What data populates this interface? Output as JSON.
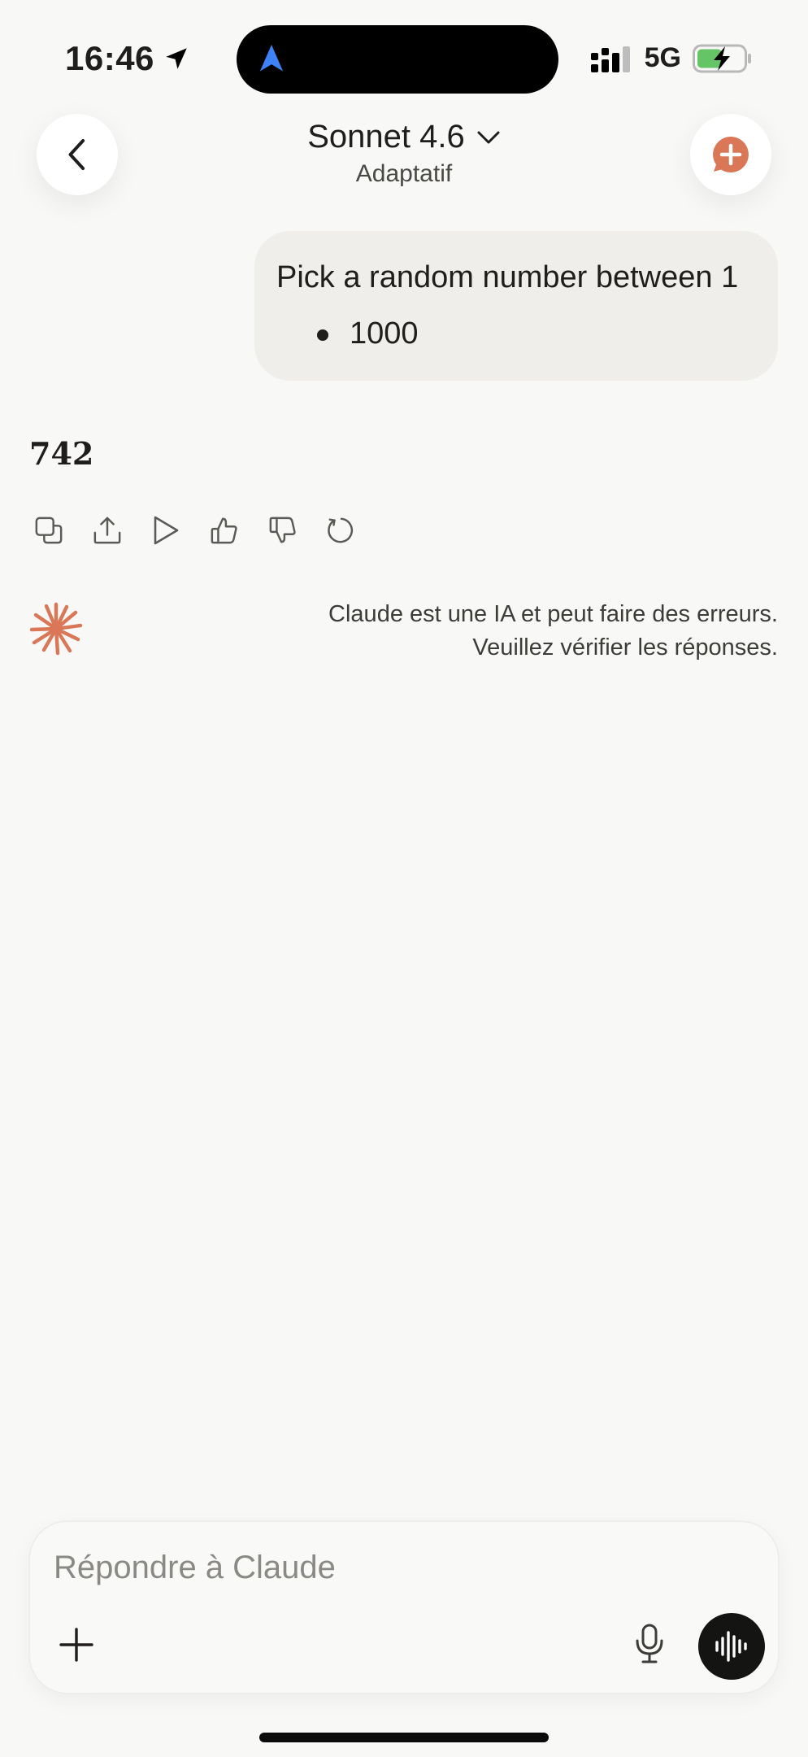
{
  "status_bar": {
    "time": "16:46",
    "network": "5G"
  },
  "header": {
    "model_name": "Sonnet 4.6",
    "model_mode": "Adaptatif"
  },
  "conversation": {
    "user_message": "Pick a random number between 1",
    "user_message_bullet": "1000",
    "assistant_reply": "742"
  },
  "disclaimer": {
    "line1": "Claude est une IA et peut faire des erreurs.",
    "line2": "Veuillez vérifier les réponses."
  },
  "composer": {
    "placeholder": "Répondre à Claude"
  },
  "colors": {
    "accent": "#d97757",
    "background": "#f8f8f6",
    "battery": "#65c466"
  }
}
